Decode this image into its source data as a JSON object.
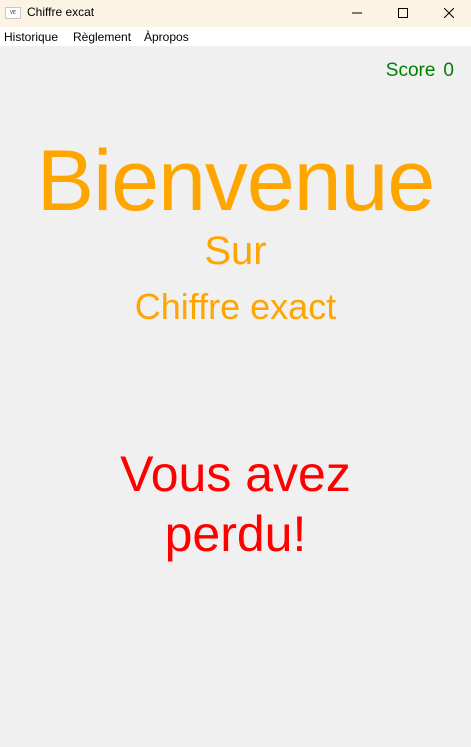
{
  "window": {
    "title": "Chiffre excat",
    "icon_label": "VE"
  },
  "menu": {
    "items": [
      {
        "label": "Historique"
      },
      {
        "label": "Règlement"
      },
      {
        "label": "Àpropos"
      }
    ]
  },
  "score": {
    "label": "Score",
    "value": "0"
  },
  "main": {
    "welcome": "Bienvenue",
    "sur": "Sur",
    "game_name": "Chiffre exact",
    "status_line1": "Vous avez",
    "status_line2": "perdu!"
  },
  "colors": {
    "welcome": "#ffa500",
    "score": "#008000",
    "lost": "#ff0000"
  }
}
